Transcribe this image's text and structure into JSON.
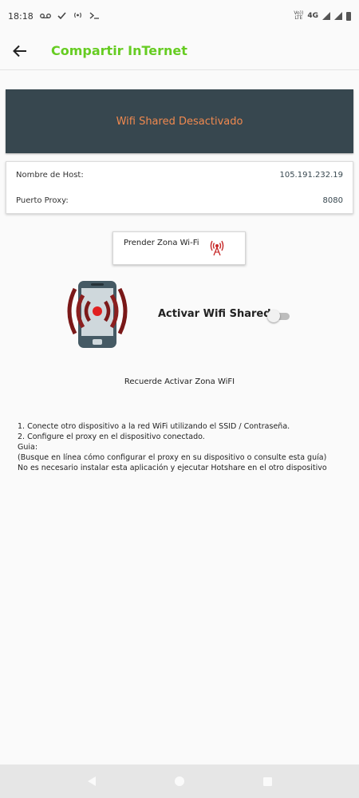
{
  "status_bar": {
    "time": "18:18",
    "icons": [
      "voicemail-icon",
      "check-icon",
      "broadcast-icon",
      "terminal-icon"
    ],
    "volte_line1": "Vo))",
    "volte_line2": "LTE",
    "network": "4G"
  },
  "app_bar": {
    "title": "Compartir InTernet",
    "title_color": "#66cc22"
  },
  "banner": {
    "text": "Wifi Shared Desactivado",
    "bg_color": "#37474f",
    "text_color": "#f0894f"
  },
  "info": {
    "host_label": "Nombre de Host:",
    "host_value": "105.191.232.19",
    "proxy_label": "Puerto Proxy:",
    "proxy_value": "8080"
  },
  "hotspot_button": {
    "label": "Prender Zona Wi-Fi",
    "icon": "wifi-hotspot-icon"
  },
  "activate": {
    "label": "Activar Wifi Shared",
    "enabled": false
  },
  "reminder": "Recuerde Activar Zona WiFI",
  "instructions": {
    "line1": "1. Conecte otro dispositivo a la red WiFi utilizando el SSID / Contraseña.",
    "line2": "2. Configure el proxy en el dispositivo conectado.",
    "line3": "Guia:",
    "line4": "(Busque en línea cómo configurar el proxy en su dispositivo o consulte esta guía)",
    "line5": "No es necesario instalar esta aplicación y ejecutar Hotshare en el otro dispositivo"
  }
}
